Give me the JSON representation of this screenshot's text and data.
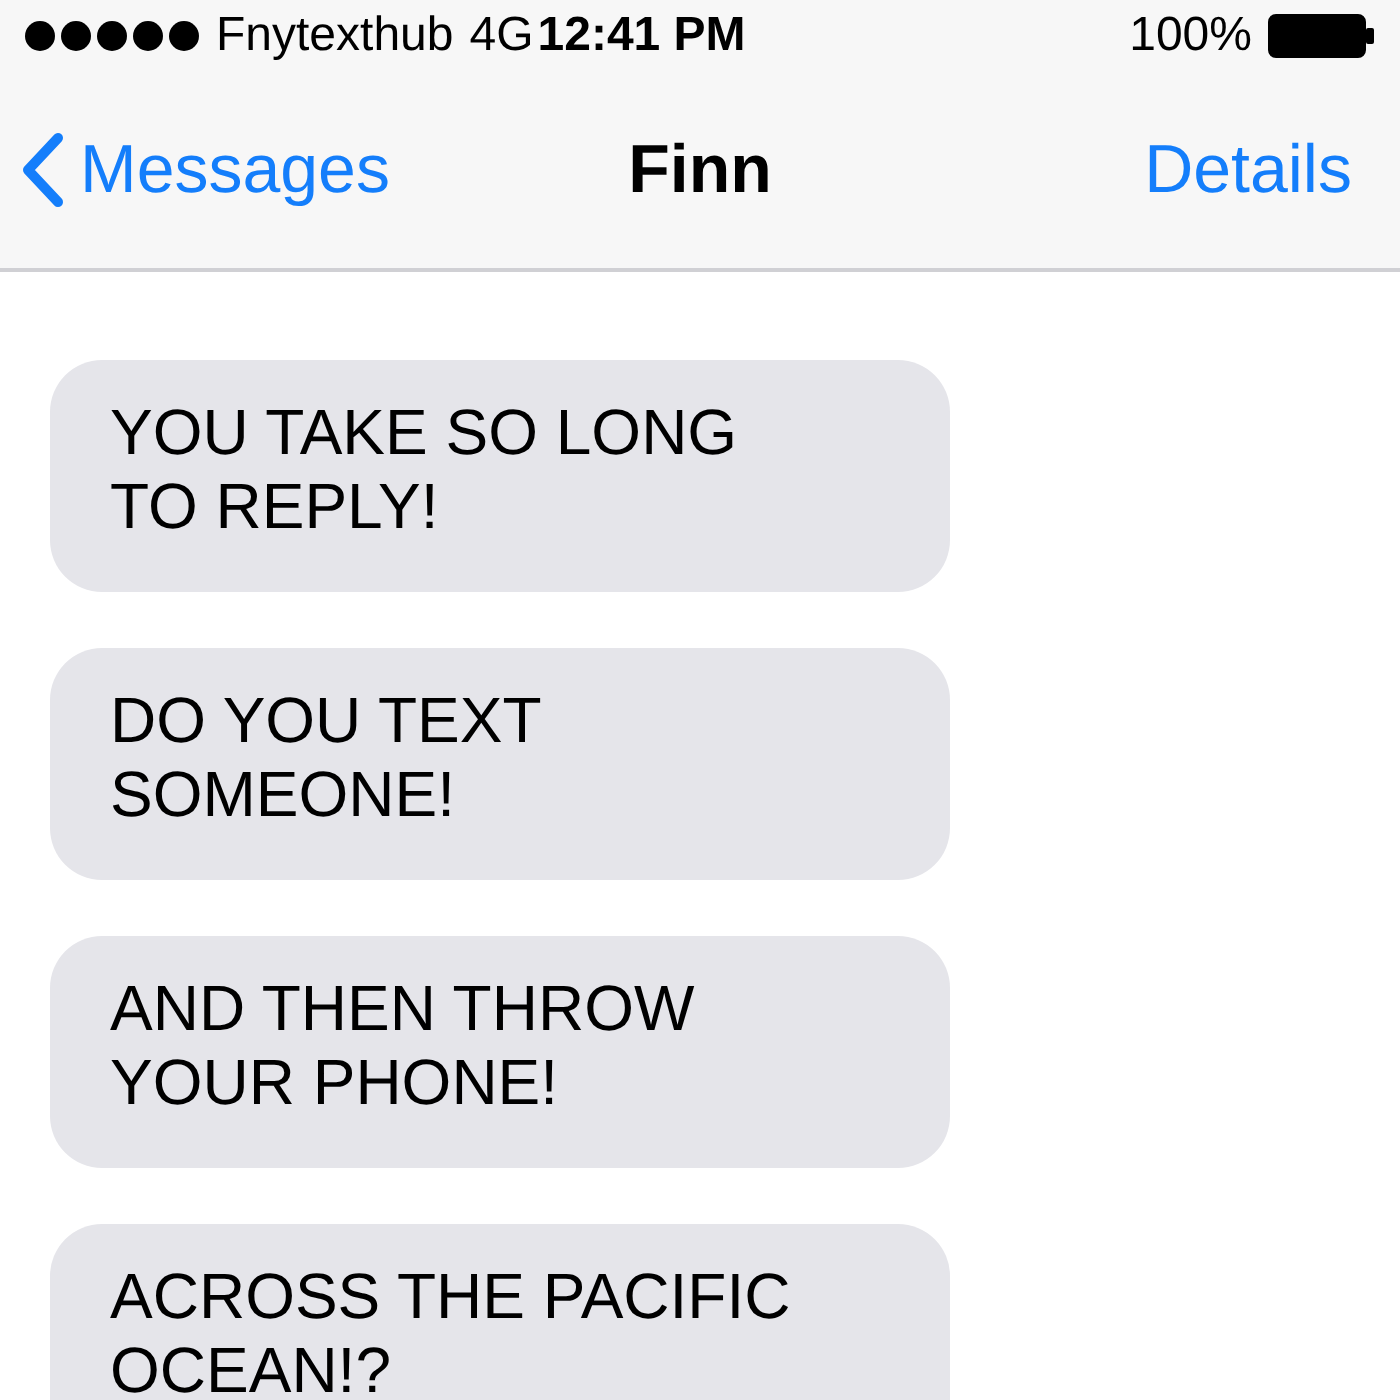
{
  "status_bar": {
    "carrier": "Fnytexthub",
    "network": "4G",
    "time": "12:41 PM",
    "battery": "100%"
  },
  "nav": {
    "back": "Messages",
    "title": "Finn",
    "action": "Details"
  },
  "messages": [
    {
      "text": "YOU TAKE SO LONG TO REPLY!"
    },
    {
      "text": "DO YOU TEXT SOMEONE!"
    },
    {
      "text": "AND THEN THROW YOUR PHONE!"
    },
    {
      "text": "ACROSS THE PACIFIC OCEAN!?"
    }
  ]
}
